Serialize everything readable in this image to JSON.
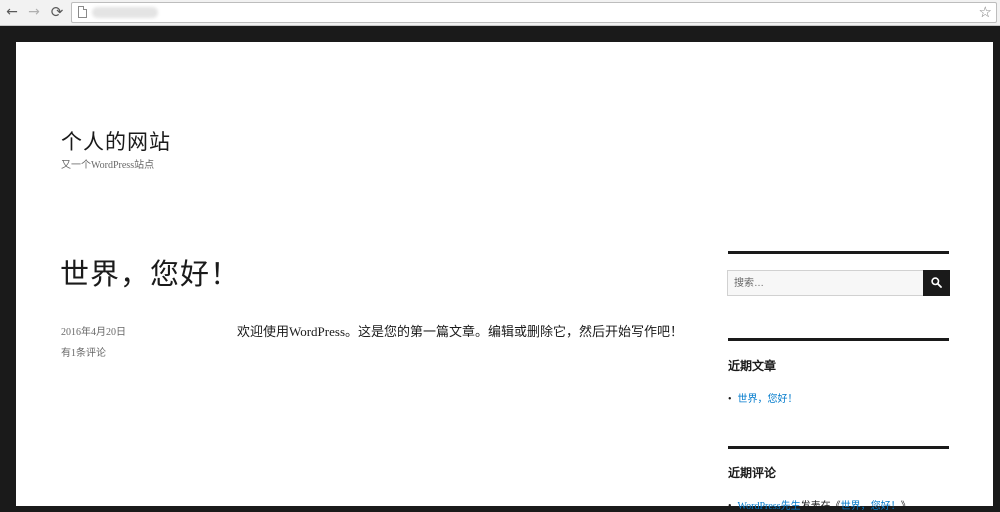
{
  "browser": {
    "back_glyph": "←",
    "forward_glyph": "→",
    "reload_glyph": "⟳",
    "star_glyph": "☆"
  },
  "site": {
    "title": "个人的网站",
    "description": "又一个WordPress站点"
  },
  "post": {
    "title": "世界，您好！",
    "date": "2016年4月20日",
    "comments_link": "有1条评论",
    "body": "欢迎使用WordPress。这是您的第一篇文章。编辑或删除它，然后开始写作吧！"
  },
  "sidebar": {
    "search": {
      "placeholder": "搜索…"
    },
    "recent_posts": {
      "title": "近期文章",
      "items": [
        {
          "label": "世界，您好！"
        }
      ]
    },
    "recent_comments": {
      "title": "近期评论",
      "items": [
        {
          "author": "WordPress先生",
          "middle": "发表在《",
          "post": "世界，您好！",
          "end": "》"
        }
      ]
    }
  },
  "colors": {
    "frame": "#1a1a1a",
    "link": "#007acc",
    "text": "#1a1a1a",
    "meta": "#686868"
  }
}
